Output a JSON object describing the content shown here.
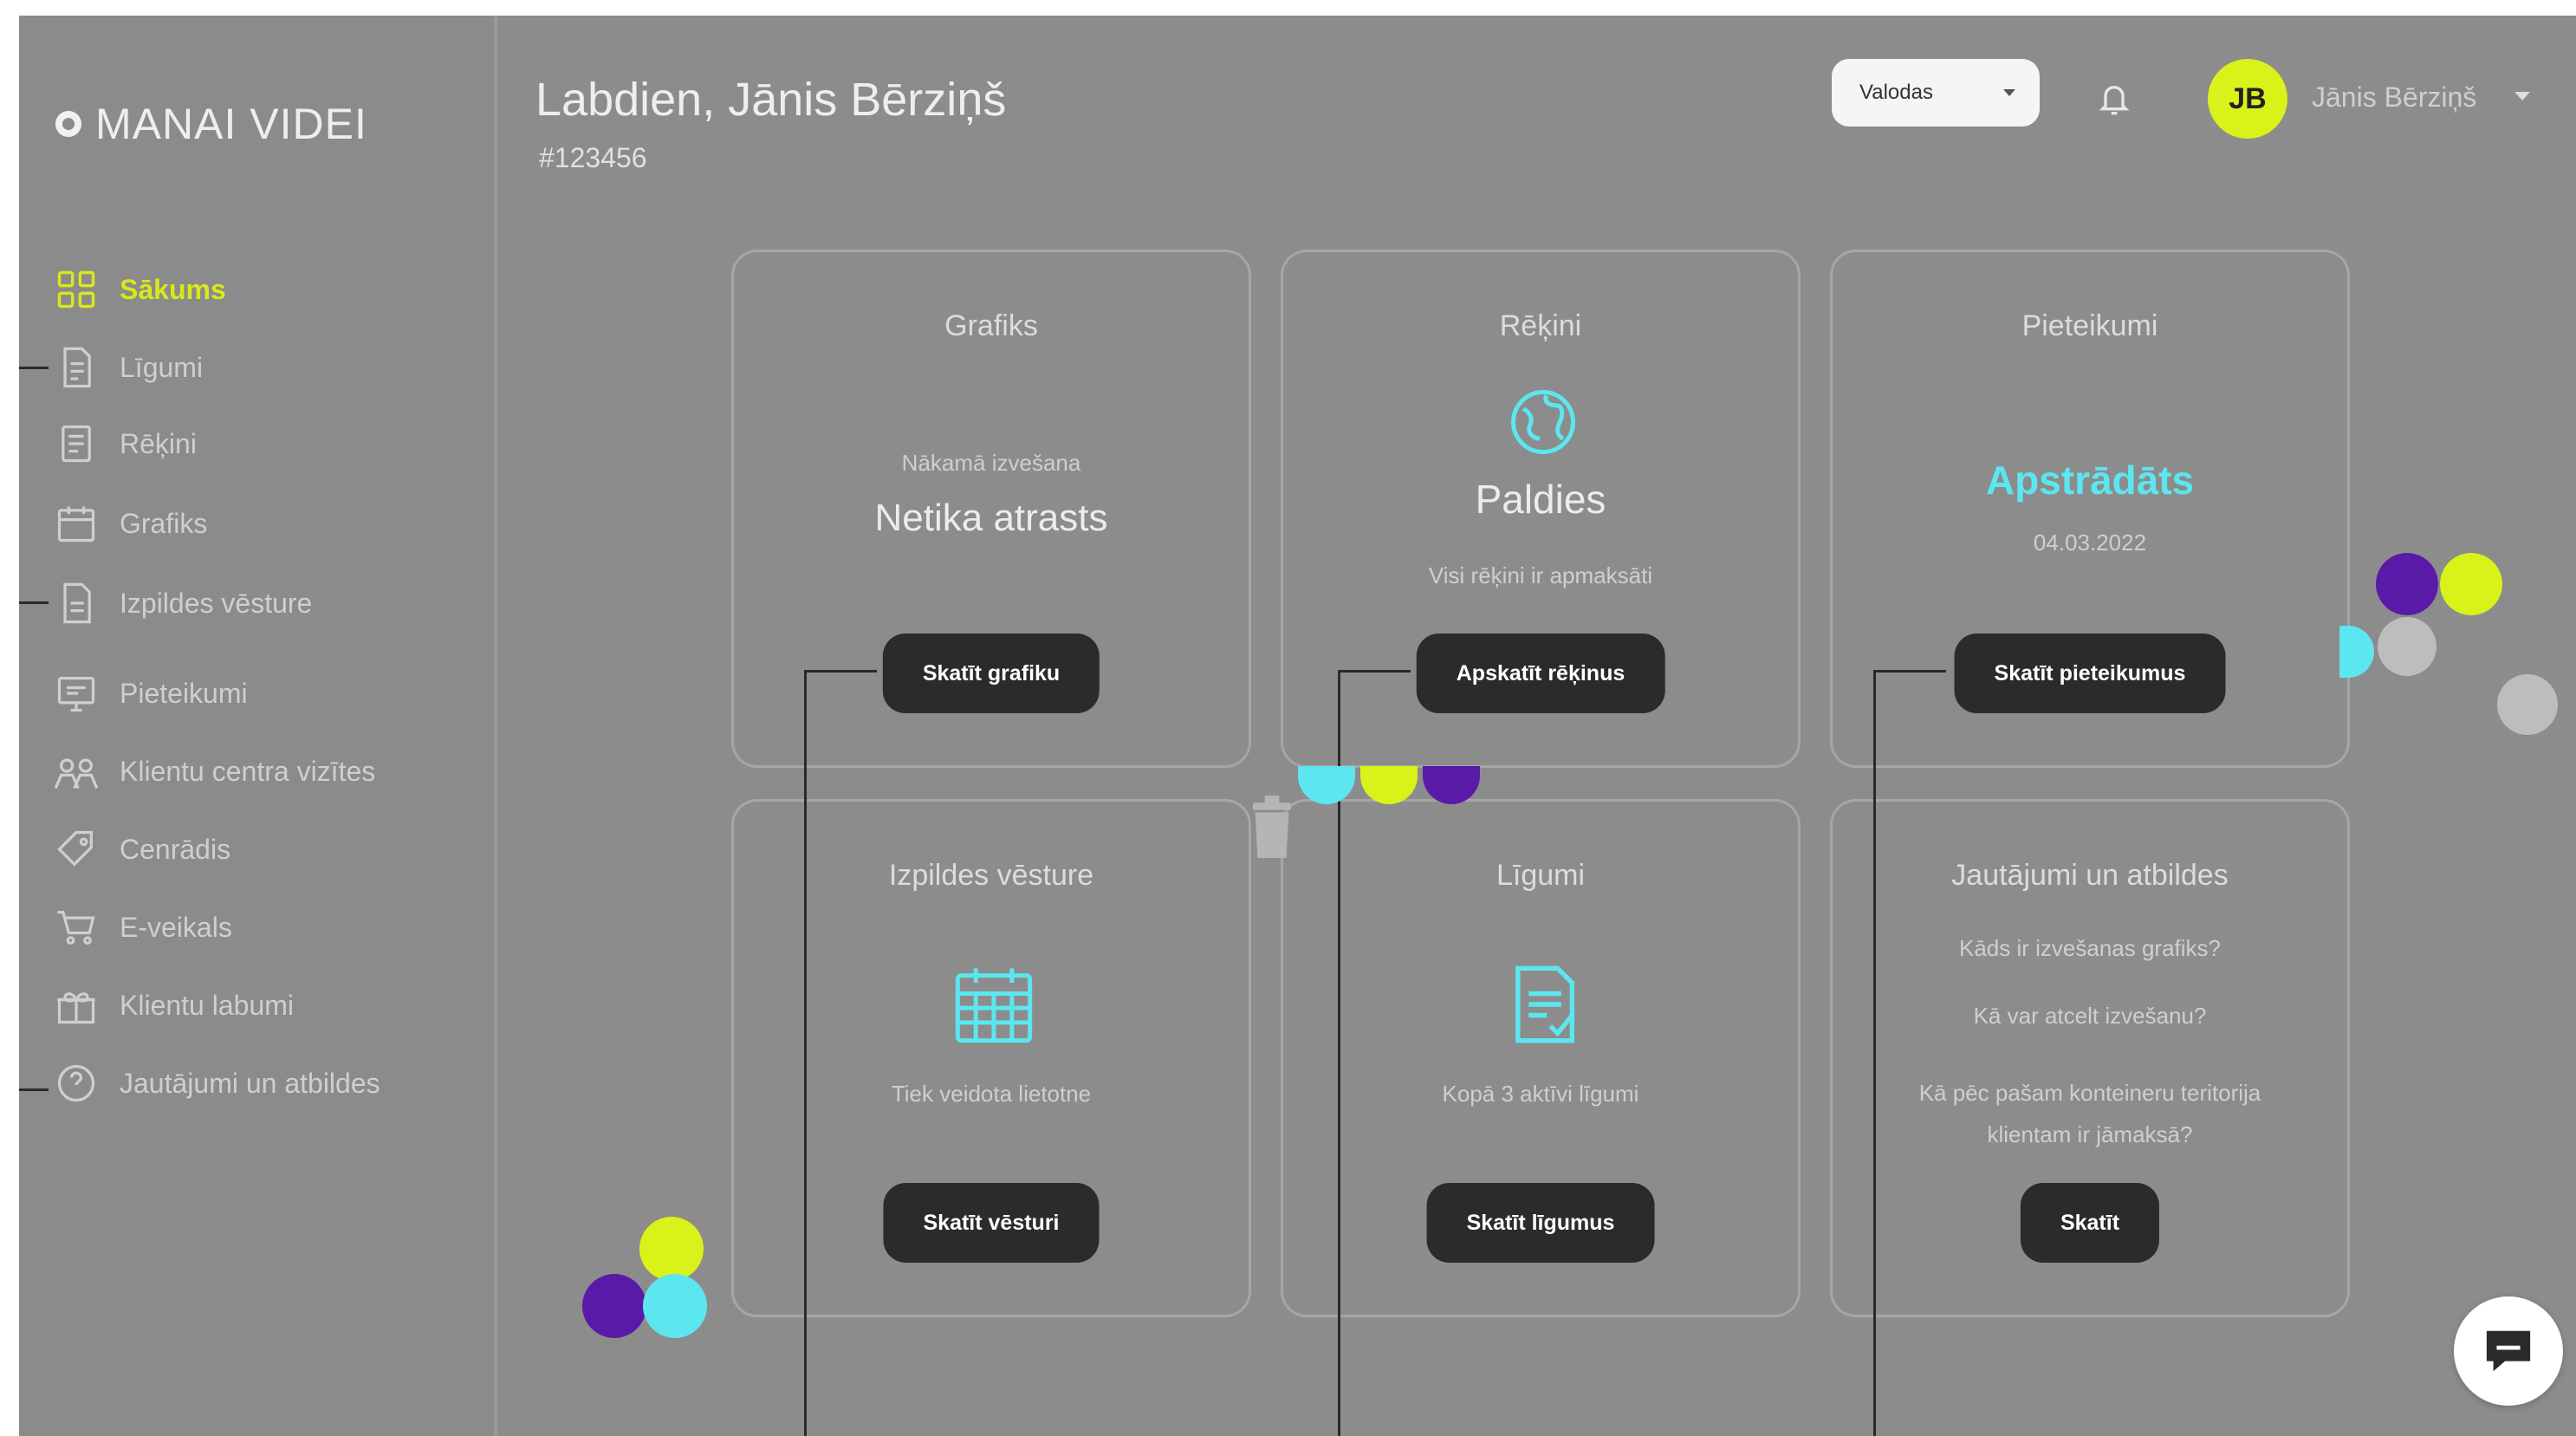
{
  "brand": {
    "logo_text": "MANAI VIDEI"
  },
  "colors": {
    "accent": "#d8e81c",
    "cyan": "#5ce6f0",
    "purple": "#5a1aa8",
    "button_bg": "#2b2b2b",
    "background": "#8c8c8c"
  },
  "sidebar": {
    "items": [
      {
        "label": "Sākums",
        "icon": "dashboard-icon",
        "active": true
      },
      {
        "label": "Līgumi",
        "icon": "contract-icon",
        "active": false
      },
      {
        "label": "Rēķini",
        "icon": "invoice-icon",
        "active": false
      },
      {
        "label": "Grafiks",
        "icon": "calendar-icon",
        "active": false
      },
      {
        "label": "Izpildes vēsture",
        "icon": "document-history-icon",
        "active": false
      },
      {
        "label": "Pieteikumi",
        "icon": "application-icon",
        "active": false
      },
      {
        "label": "Klientu centra vizītes",
        "icon": "people-icon",
        "active": false
      },
      {
        "label": "Cenrādis",
        "icon": "price-tag-icon",
        "active": false
      },
      {
        "label": "E-veikals",
        "icon": "cart-icon",
        "active": false
      },
      {
        "label": "Klientu labumi",
        "icon": "gift-icon",
        "active": false
      },
      {
        "label": "Jautājumi un atbildes",
        "icon": "faq-icon",
        "active": false
      }
    ]
  },
  "header": {
    "greeting": "Labdien, Jānis Bērziņš",
    "account_number": "#123456",
    "language_label": "Valodas",
    "user_initials": "JB",
    "user_name": "Jānis Bērziņš"
  },
  "cards": {
    "schedule": {
      "title": "Grafiks",
      "subtitle": "Nākamā izvešana",
      "value": "Netika atrasts",
      "button": "Skatīt grafiku"
    },
    "invoices": {
      "title": "Rēķini",
      "value": "Paldies",
      "note": "Visi rēķini ir apmaksāti",
      "button": "Apskatīt rēķinus"
    },
    "applications": {
      "title": "Pieteikumi",
      "status": "Apstrādāts",
      "date": "04.03.2022",
      "button": "Skatīt pieteikumus"
    },
    "history": {
      "title": "Izpildes vēsture",
      "note": "Tiek veidota lietotne",
      "button": "Skatīt vēsturi"
    },
    "contracts": {
      "title": "Līgumi",
      "note": "Kopā 3 aktīvi līgumi",
      "button": "Skatīt līgumus"
    },
    "faq": {
      "title": "Jautājumi un atbildes",
      "questions": [
        "Kāds ir izvešanas grafiks?",
        "Kā var atcelt izvešanu?",
        "Kā pēc pašam konteineru teritorija klientam ir jāmaksā?"
      ],
      "button": "Skatīt"
    }
  }
}
